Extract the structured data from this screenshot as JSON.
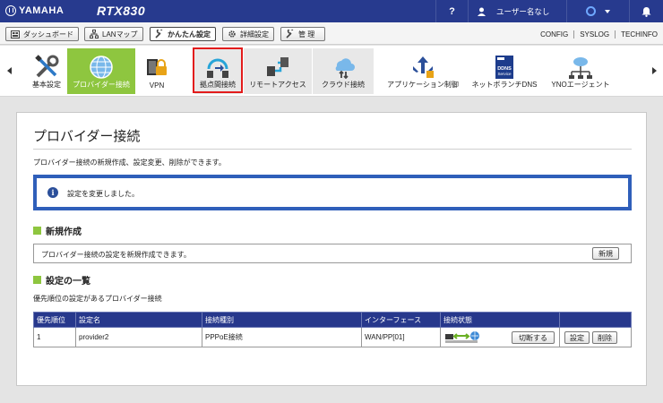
{
  "header": {
    "brand": "YAMAHA",
    "model": "RTX830",
    "help": "?",
    "user": "ユーザー名なし"
  },
  "nav": {
    "buttons": [
      "ダッシュボード",
      "LANマップ",
      "かんたん設定",
      "詳細設定",
      "管 理"
    ],
    "links": [
      "CONFIG",
      "SYSLOG",
      "TECHINFO"
    ]
  },
  "toolbar": {
    "items": [
      "基本設定",
      "プロバイダー接続",
      "VPN",
      "拠点間接続",
      "リモートアクセス",
      "クラウド接続",
      "アプリケーション制御",
      "ネットボランチDNS",
      "YNOエージェント"
    ],
    "ddns_badge": "DDNS Service"
  },
  "main": {
    "title": "プロバイダー接続",
    "description": "プロバイダー接続の新規作成、設定変更、削除ができます。",
    "notice": "設定を変更しました。",
    "create": {
      "heading": "新規作成",
      "text": "プロバイダー接続の設定を新規作成できます。",
      "button": "新規"
    },
    "list": {
      "heading": "設定の一覧",
      "subtitle": "優先順位の設定があるプロバイダー接続",
      "columns": [
        "優先順位",
        "設定名",
        "接続種別",
        "インターフェース",
        "接続状態",
        ""
      ],
      "rows": [
        {
          "priority": "1",
          "name": "provider2",
          "type": "PPPoE接続",
          "interface": "WAN/PP[01]",
          "switch_button": "切断する",
          "edit_button": "設定",
          "delete_button": "削除"
        }
      ]
    }
  },
  "colors": {
    "header_bg": "#273a8e",
    "selected_green": "#8ec63f",
    "notice_border": "#2f5fba",
    "highlight_red": "#e21b1b"
  }
}
